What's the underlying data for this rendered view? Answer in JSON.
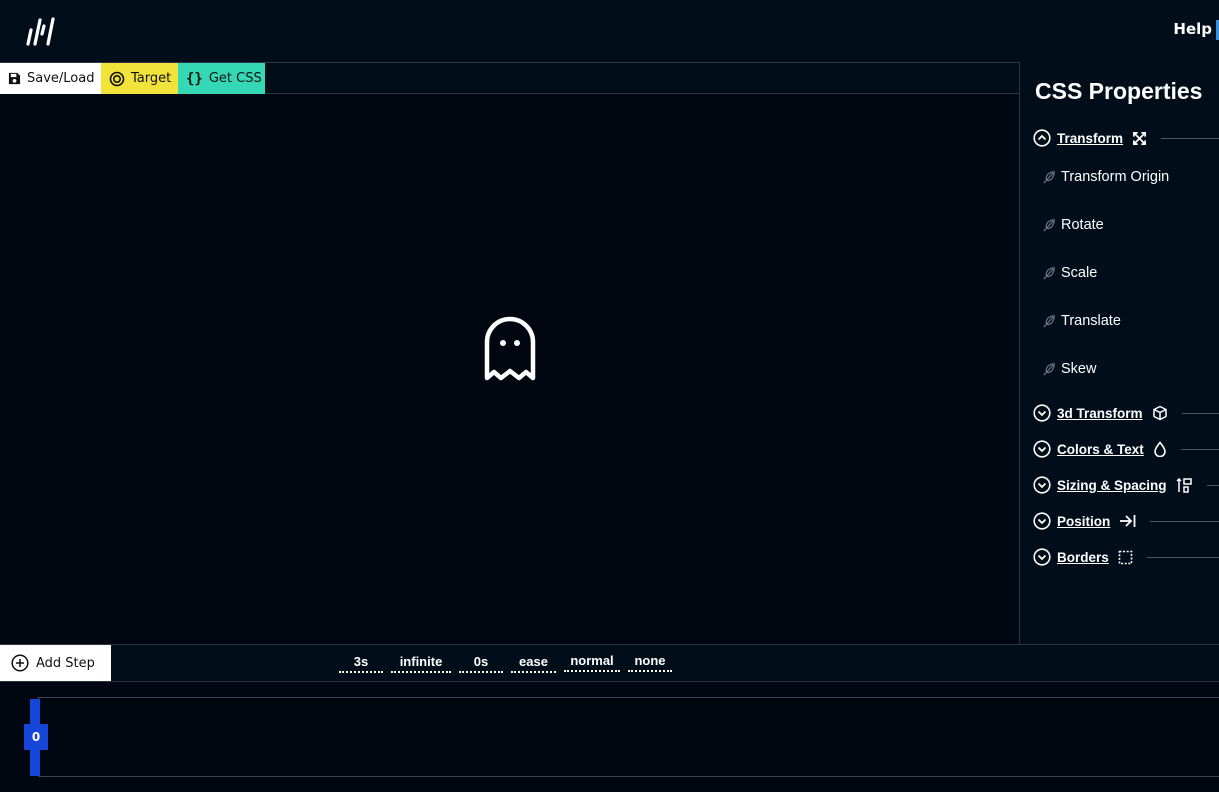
{
  "header": {
    "help_label": "Help"
  },
  "toolbar": {
    "save_load_label": "Save/Load",
    "target_label": "Target",
    "get_css_label": "Get CSS"
  },
  "panel": {
    "title": "CSS Properties",
    "sections": [
      {
        "label": "Transform",
        "expanded": true,
        "icon": "expand-arrows-icon"
      },
      {
        "label": "3d Transform",
        "expanded": false,
        "icon": "cube-icon"
      },
      {
        "label": "Colors & Text",
        "expanded": false,
        "icon": "droplet-icon"
      },
      {
        "label": "Sizing & Spacing",
        "expanded": false,
        "icon": "sizing-icon"
      },
      {
        "label": "Position",
        "expanded": false,
        "icon": "arrow-to-line-icon"
      },
      {
        "label": "Borders",
        "expanded": false,
        "icon": "dashed-square-icon"
      }
    ],
    "transform_items": [
      "Transform Origin",
      "Rotate",
      "Scale",
      "Translate",
      "Skew"
    ]
  },
  "bottombar": {
    "add_step_label": "Add Step",
    "duration": "3s",
    "iteration_count": "infinite",
    "delay": "0s",
    "timing_function": "ease",
    "direction": "normal",
    "fill_mode": "none"
  },
  "timeline": {
    "marker_label": "0"
  },
  "colors": {
    "background": "#020b18",
    "target_button": "#f2e33a",
    "get_css_button": "#35d8b4",
    "timeline_marker": "#1546d8"
  }
}
